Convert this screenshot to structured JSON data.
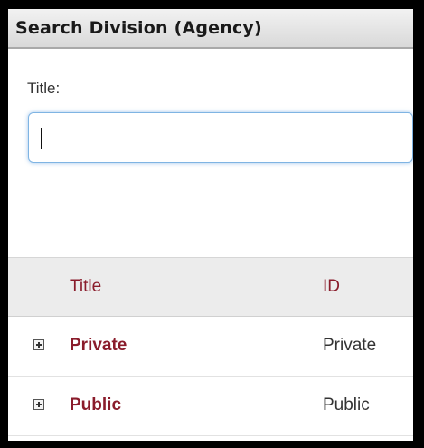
{
  "panel": {
    "title": "Search Division (Agency)"
  },
  "form": {
    "title_label": "Title:",
    "title_value": ""
  },
  "grid": {
    "columns": {
      "title": "Title",
      "id": "ID"
    },
    "rows": [
      {
        "title": "Private",
        "id": "Private",
        "expand_icon": "plus-square-icon"
      },
      {
        "title": "Public",
        "id": "Public",
        "expand_icon": "plus-square-icon"
      }
    ]
  },
  "colors": {
    "link": "#8a1c2b",
    "focus_border": "#7fb4e3",
    "header_bg": "#ececec"
  }
}
